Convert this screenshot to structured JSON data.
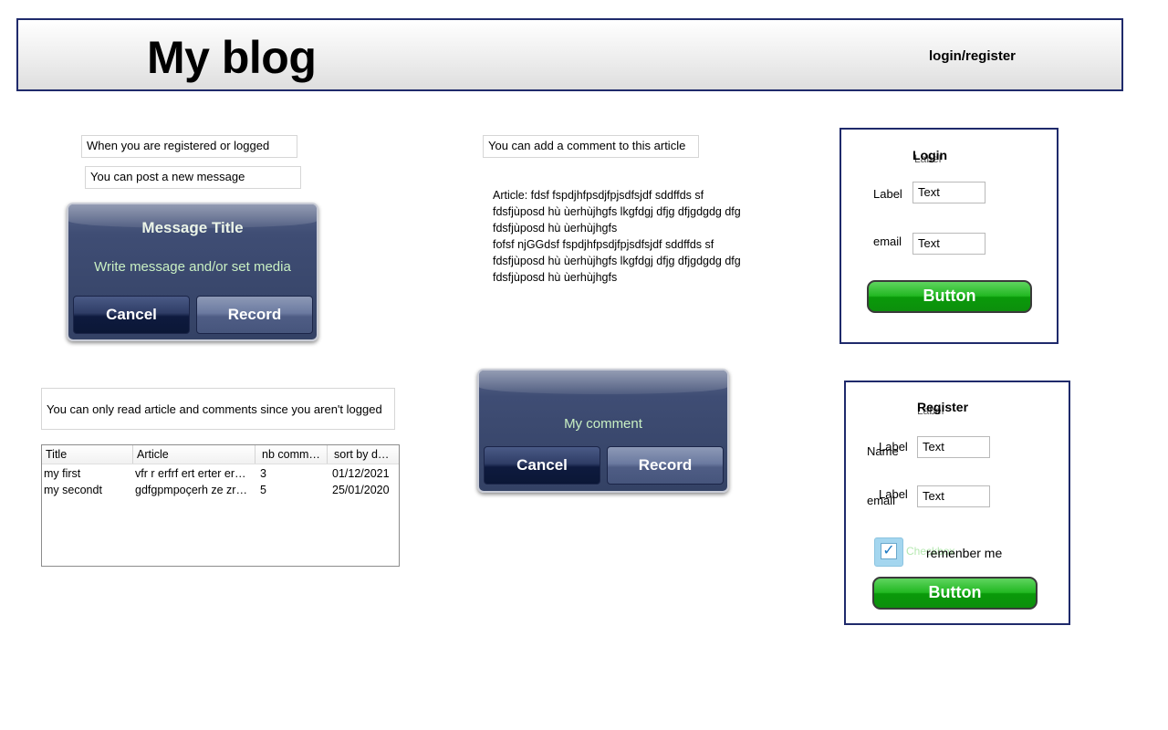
{
  "header": {
    "title": "My blog",
    "login_link": "login/register"
  },
  "left": {
    "note1": "When you are registered or logged",
    "note2": "You can post a new message",
    "message_dialog": {
      "title": "Message Title",
      "message": "Write message and/or set media",
      "cancel": "Cancel",
      "record": "Record"
    },
    "readonly_note": "You can only read article and comments since you aren't logged",
    "table": {
      "columns": [
        "Title",
        "Article",
        "nb comm…",
        "sort by d…"
      ],
      "rows": [
        [
          "my first",
          "vfr r erfrf ert  erter er…",
          "3",
          "01/12/2021"
        ],
        [
          "my secondt",
          "gdfgpmpoçerh ze zr…",
          "5",
          "25/01/2020"
        ]
      ]
    }
  },
  "center": {
    "comment_note": "You can add a comment to this article",
    "article_lines": [
      "Article: fdsf  fspdjhfpsdjfpjsdfsjdf sddffds sf",
      "fdsfjùposd hù ùerhùjhgfs lkgfdgj dfjg dfjgdgdg dfg",
      "fdsfjùposd hù ùerhùjhgfs",
      "fofsf njGGdsf  fspdjhfpsdjfpjsdfsjdf sddffds sf",
      "fdsfjùposd hù ùerhùjhgfs lkgfdgj dfjg dfjgdgdg dfg",
      "fdsfjùposd hù ùerhùjhgfs"
    ],
    "comment_dialog": {
      "message": "My comment",
      "cancel": "Cancel",
      "record": "Record"
    }
  },
  "login_panel": {
    "title": "Login",
    "ghost_label": "Label",
    "field1_label": "Label",
    "field1_value": "Text",
    "field2_label": "email",
    "field2_value": "Text",
    "button": "Button"
  },
  "register_panel": {
    "title": "Register",
    "ghost_label": "Label",
    "field1_label": "Label",
    "field1_sublabel": "Name",
    "field1_value": "Text",
    "field2_label": "Label",
    "field2_sublabel": "email",
    "field2_value": "Text",
    "checkbox_ghost": "Checkbox",
    "checkbox_label": "remenber me",
    "checkbox_checked": true,
    "button": "Button"
  },
  "colors": {
    "border_navy": "#1f2a6b",
    "dialog_blue": "#3f4d74",
    "button_green": "#22b822",
    "dialog_text_green": "#c9f0c3"
  }
}
